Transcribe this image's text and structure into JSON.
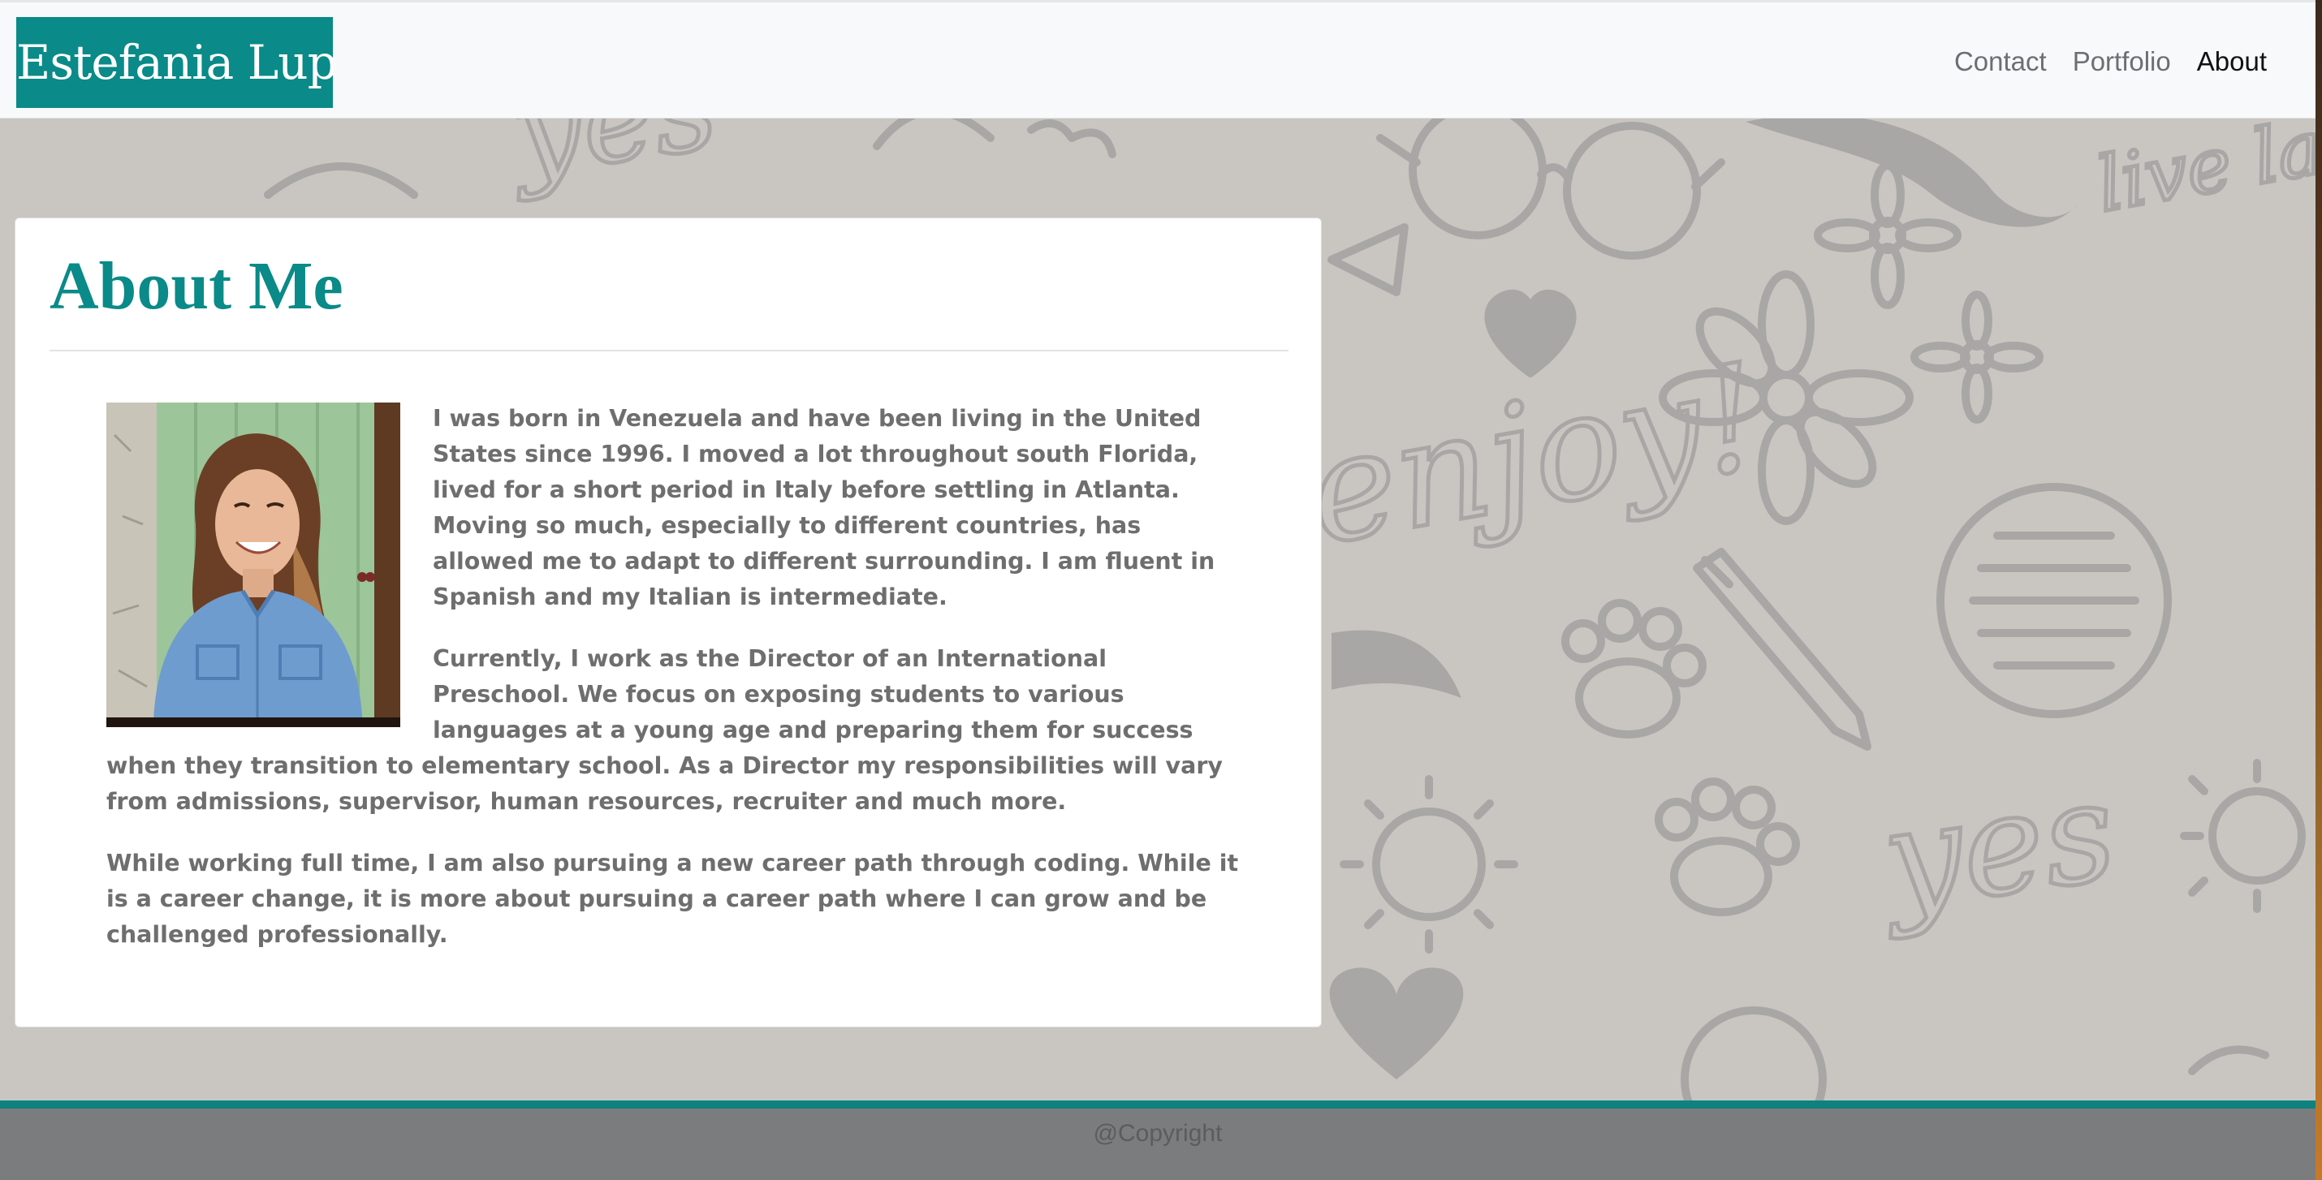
{
  "navbar": {
    "brand": "Estefania Lupo",
    "links": [
      "Contact",
      "Portfolio",
      "About"
    ],
    "active_link": "About"
  },
  "about": {
    "title": "About Me",
    "paragraphs": [
      "I was born in Venezuela and have been living in the United States since 1996. I moved a lot throughout south Florida, lived for a short period in Italy before settling in Atlanta. Moving so much, especially to different countries, has allowed me to adapt to different surrounding. I am fluent in Spanish and my Italian is intermediate.",
      "Currently, I work as the Director of an International Preschool. We focus on exposing students to various languages at a young age and preparing them for success when they transition to elementary school. As a Director my responsibilities will vary from admissions, supervisor, human resources, recruiter and much more.",
      "While working full time, I am also pursuing a new career path through coding. While it is a career change, it is more about pursuing a career path where I can grow and be challenged professionally."
    ]
  },
  "footer": {
    "copyright": "@Copyright"
  },
  "background_doodles": [
    "yes",
    "enjoy!",
    "live laugh love",
    "yes"
  ],
  "colors": {
    "brand_teal": "#0a8a88",
    "footer_teal_bar": "#0f8181",
    "footer_bg": "#7b7c7d",
    "page_bg": "#c9c6c2",
    "nav_bg": "#f8f9fa",
    "doodle": "#a9a7a5"
  }
}
